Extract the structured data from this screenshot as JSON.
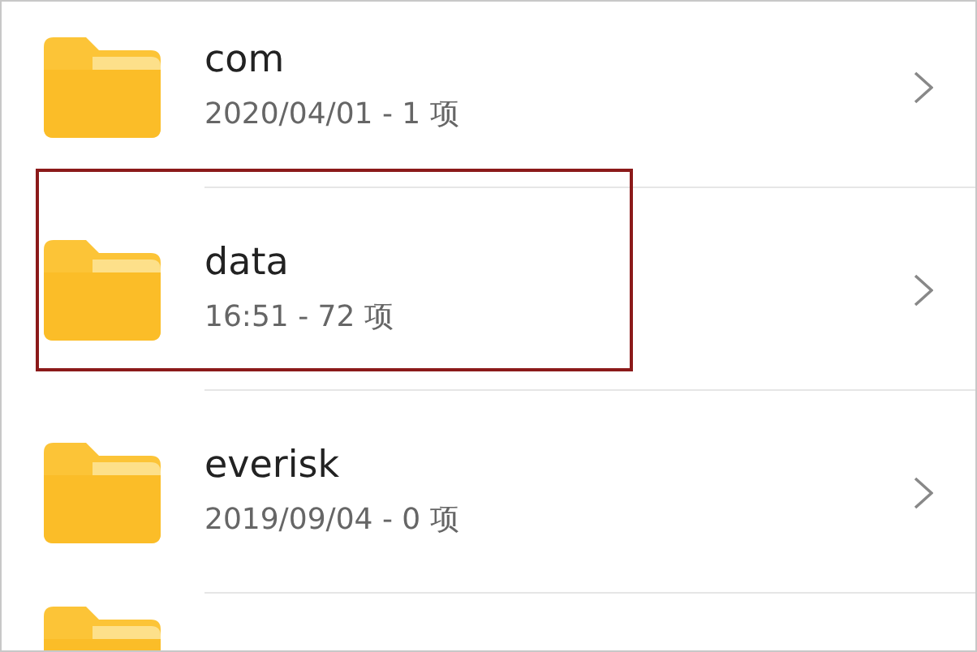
{
  "folders": [
    {
      "name": "com",
      "details": "2020/04/01 - 1 项",
      "highlighted": false
    },
    {
      "name": "data",
      "details": "16:51 - 72 项",
      "highlighted": true
    },
    {
      "name": "everisk",
      "details": "2019/09/04 - 0 项",
      "highlighted": false
    }
  ],
  "more_below": true
}
